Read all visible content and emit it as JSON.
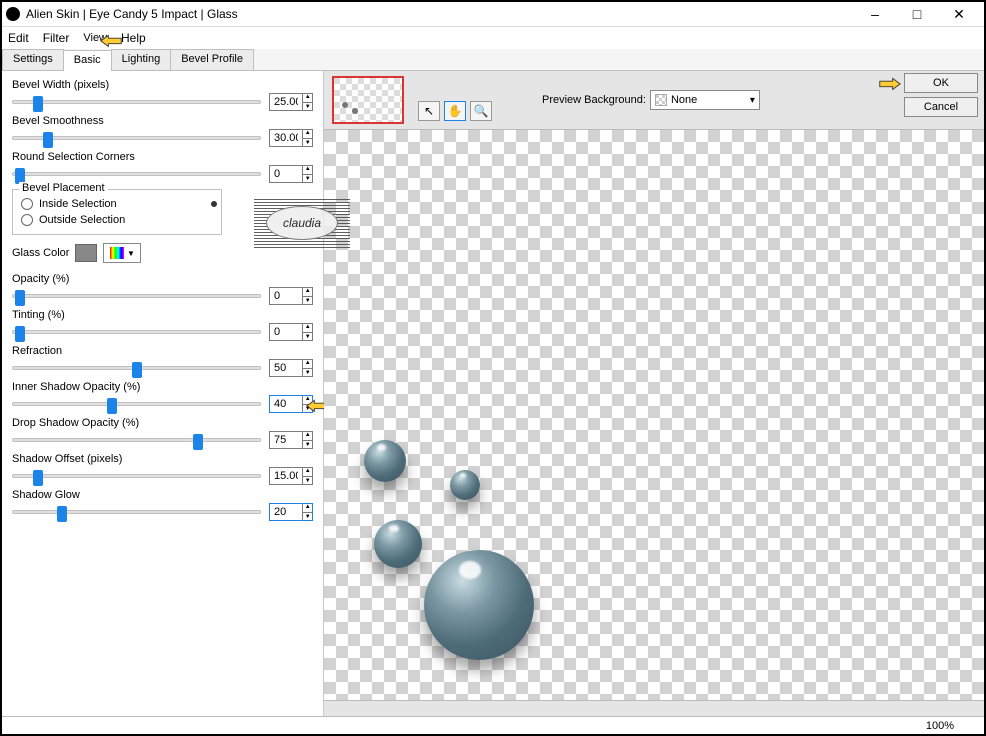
{
  "window": {
    "title": "Alien Skin | Eye Candy 5 Impact | Glass"
  },
  "menu": {
    "edit": "Edit",
    "filter": "Filter",
    "view": "View",
    "help": "Help"
  },
  "tabs": {
    "settings": "Settings",
    "basic": "Basic",
    "lighting": "Lighting",
    "bevel": "Bevel Profile"
  },
  "buttons": {
    "ok": "OK",
    "cancel": "Cancel"
  },
  "previewbg": {
    "label": "Preview Background:",
    "value": "None"
  },
  "status": {
    "zoom": "100%"
  },
  "watermark": {
    "text": "claudia"
  },
  "params": {
    "bevel_width": {
      "label": "Bevel Width (pixels)",
      "value": "25.00",
      "pos": 10
    },
    "bevel_smoothness": {
      "label": "Bevel Smoothness",
      "value": "30.00",
      "pos": 14
    },
    "round_corners": {
      "label": "Round Selection Corners",
      "value": "0",
      "pos": 3
    },
    "opacity": {
      "label": "Opacity (%)",
      "value": "0",
      "pos": 3
    },
    "tinting": {
      "label": "Tinting (%)",
      "value": "0",
      "pos": 3
    },
    "refraction": {
      "label": "Refraction",
      "value": "50",
      "pos": 50
    },
    "inner_shadow": {
      "label": "Inner Shadow Opacity (%)",
      "value": "40",
      "pos": 40
    },
    "drop_shadow": {
      "label": "Drop Shadow Opacity (%)",
      "value": "75",
      "pos": 75
    },
    "shadow_offset": {
      "label": "Shadow Offset (pixels)",
      "value": "15.00",
      "pos": 10
    },
    "shadow_glow": {
      "label": "Shadow Glow",
      "value": "20",
      "pos": 20
    }
  },
  "bevel_placement": {
    "title": "Bevel Placement",
    "inside": "Inside Selection",
    "outside": "Outside Selection"
  },
  "glass_color_label": "Glass Color"
}
